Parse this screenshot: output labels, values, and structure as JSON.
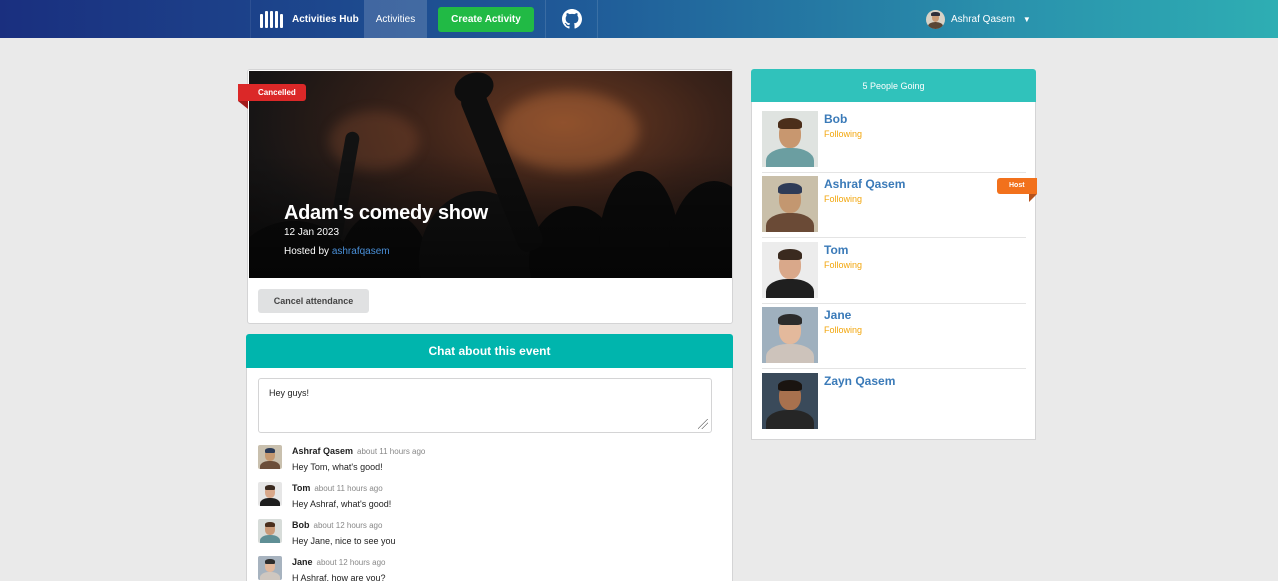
{
  "navbar": {
    "brand": "Activities Hub",
    "activities": "Activities",
    "create": "Create Activity",
    "user": "Ashraf Qasem"
  },
  "event": {
    "status": "Cancelled",
    "title": "Adam's comedy show",
    "date": "12 Jan 2023",
    "hosted_by_prefix": "Hosted by ",
    "host_username": "ashrafqasem",
    "cancel_button": "Cancel attendance"
  },
  "chat": {
    "header": "Chat about this event",
    "input_value": "Hey guys!",
    "comments": [
      {
        "author": "Ashraf Qasem",
        "time": "about 11 hours ago",
        "text": "Hey Tom, what's good!"
      },
      {
        "author": "Tom",
        "time": "about 11 hours ago",
        "text": "Hey Ashraf, what's good!"
      },
      {
        "author": "Bob",
        "time": "about 12 hours ago",
        "text": "Hey Jane, nice to see you"
      },
      {
        "author": "Jane",
        "time": "about 12 hours ago",
        "text": "H Ashraf, how are you?"
      }
    ]
  },
  "sidebar": {
    "header": "5 People Going",
    "host_label": "Host",
    "attendees": [
      {
        "name": "Bob",
        "following": "Following"
      },
      {
        "name": "Ashraf Qasem",
        "following": "Following"
      },
      {
        "name": "Tom",
        "following": "Following"
      },
      {
        "name": "Jane",
        "following": "Following"
      },
      {
        "name": "Zayn Qasem",
        "following": ""
      }
    ]
  },
  "colors": {
    "accent_teal": "#00b5ad",
    "create_green": "#21ba45",
    "cancel_red": "#db2828",
    "host_orange": "#f2711c",
    "following": "#f2a60c",
    "link_blue": "#3a7ab8"
  }
}
